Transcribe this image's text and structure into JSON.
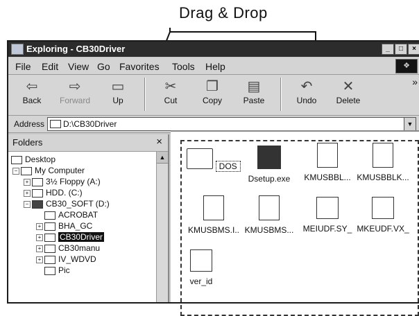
{
  "callout": {
    "text": "Drag & Drop"
  },
  "window": {
    "title": "Exploring - CB30Driver",
    "buttons": [
      "_",
      "□",
      "×"
    ]
  },
  "menu": [
    "File",
    "Edit",
    "View",
    "Go",
    "Favorites",
    "Tools",
    "Help"
  ],
  "toolbar": {
    "buttons": [
      {
        "label": "Back",
        "icon": "back-arrow-icon",
        "glyph": "⇦"
      },
      {
        "label": "Forward",
        "icon": "forward-arrow-icon",
        "glyph": "⇨"
      },
      {
        "label": "Up",
        "icon": "up-folder-icon",
        "glyph": "▭"
      },
      {
        "label": "Cut",
        "icon": "scissors-icon",
        "glyph": "✂"
      },
      {
        "label": "Copy",
        "icon": "copy-icon",
        "glyph": "❐"
      },
      {
        "label": "Paste",
        "icon": "paste-icon",
        "glyph": "▤"
      },
      {
        "label": "Undo",
        "icon": "undo-icon",
        "glyph": "↶"
      },
      {
        "label": "Delete",
        "icon": "delete-icon",
        "glyph": "✕"
      }
    ],
    "overflow": "»"
  },
  "address": {
    "label": "Address",
    "value": "D:\\CB30Driver"
  },
  "folders": {
    "title": "Folders",
    "close": "×",
    "tree": [
      "Desktop",
      "My Computer",
      "3½ Floppy (A:)",
      "HDD. (C:)",
      "CB30_SOFT (D:)",
      "ACROBAT",
      "BHA_GC",
      "CB30Driver",
      "CB30manu",
      "IV_WDVD",
      "Pic"
    ]
  },
  "files": [
    "DOS",
    "Dsetup.exe",
    "KMUSBBL...",
    "KMUSBBLK...",
    "KMUSBMS.I..",
    "KMUSBMS...",
    "MEIUDF.SY_",
    "MKEUDF.VX_",
    "ver_id"
  ]
}
